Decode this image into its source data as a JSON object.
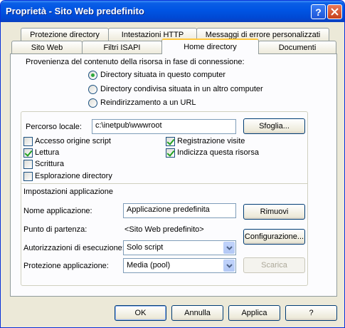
{
  "window": {
    "title": "Proprietà - Sito Web predefinito"
  },
  "tabs": {
    "row1": [
      "Protezione directory",
      "Intestazioni HTTP",
      "Messaggi di errore personalizzati"
    ],
    "row2": [
      "Sito Web",
      "Filtri ISAPI",
      "Home directory",
      "Documenti"
    ],
    "active": "Home directory"
  },
  "content_source": {
    "heading": "Provenienza del contenuto della risorsa in fase di connessione:",
    "options": [
      {
        "label": "Directory situata in questo computer",
        "checked": true
      },
      {
        "label": "Directory condivisa situata in un altro computer",
        "checked": false
      },
      {
        "label": "Reindirizzamento a un URL",
        "checked": false
      }
    ]
  },
  "local_path": {
    "label": "Percorso locale:",
    "value": "c:\\inetpub\\wwwroot",
    "browse_button": "Sfoglia..."
  },
  "permissions": {
    "script_source_access": {
      "label": "Accesso origine script",
      "checked": false
    },
    "read": {
      "label": "Lettura",
      "checked": true
    },
    "write": {
      "label": "Scrittura",
      "checked": false
    },
    "directory_browsing": {
      "label": "Esplorazione directory",
      "checked": false
    },
    "log_visits": {
      "label": "Registrazione visite",
      "checked": true
    },
    "index_resource": {
      "label": "Indicizza questa risorsa",
      "checked": true
    }
  },
  "app_settings": {
    "heading": "Impostazioni applicazione",
    "app_name_label": "Nome applicazione:",
    "app_name_value": "Applicazione predefinita",
    "remove_button": "Rimuovi",
    "start_point_label": "Punto di partenza:",
    "start_point_value": "<Sito Web predefinito>",
    "config_button": "Configurazione...",
    "exec_perms_label": "Autorizzazioni di esecuzione:",
    "exec_perms_value": "Solo script",
    "app_protection_label": "Protezione applicazione:",
    "app_protection_value": "Media (pool)",
    "unload_button": "Scarica"
  },
  "footer": {
    "ok": "OK",
    "cancel": "Annulla",
    "apply": "Applica",
    "help": "?"
  }
}
